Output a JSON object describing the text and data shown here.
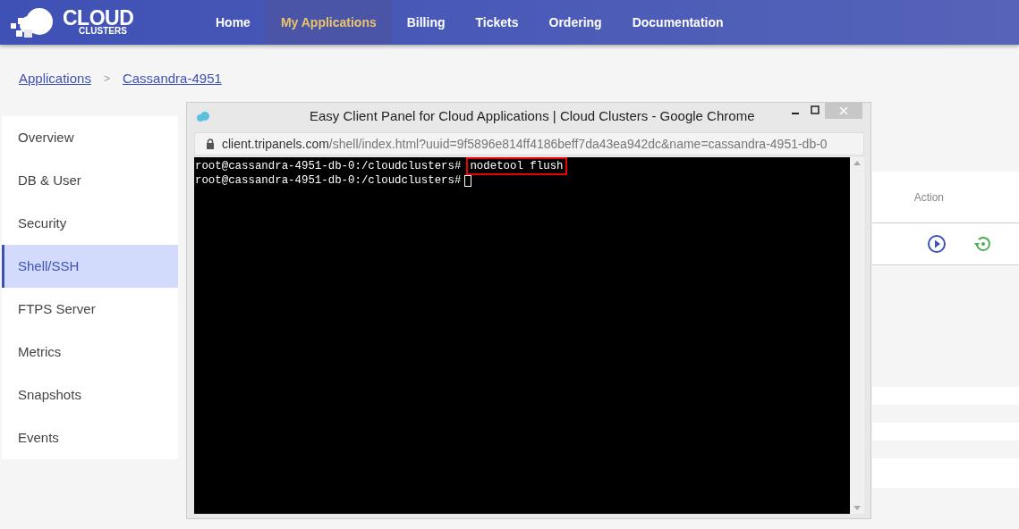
{
  "nav": [
    {
      "label": "Home",
      "selected": false
    },
    {
      "label": "My Applications",
      "selected": true
    },
    {
      "label": "Billing",
      "selected": false
    },
    {
      "label": "Tickets",
      "selected": false
    },
    {
      "label": "Ordering",
      "selected": false
    },
    {
      "label": "Documentation",
      "selected": false
    }
  ],
  "logo": {
    "line1": "CLOUD",
    "line2": "CLUSTERS"
  },
  "breadcrumb": [
    {
      "label": "Applications"
    },
    {
      "label": "Cassandra-4951"
    }
  ],
  "breadcrumb_separator": ">",
  "sidebar": [
    {
      "label": "Overview",
      "selected": false
    },
    {
      "label": "DB & User",
      "selected": false
    },
    {
      "label": "Security",
      "selected": false
    },
    {
      "label": "Shell/SSH",
      "selected": true
    },
    {
      "label": "FTPS Server",
      "selected": false
    },
    {
      "label": "Metrics",
      "selected": false
    },
    {
      "label": "Snapshots",
      "selected": false
    },
    {
      "label": "Events",
      "selected": false
    }
  ],
  "table": {
    "columns": [
      "Action"
    ]
  },
  "popup": {
    "title": "Easy Client Panel for Cloud Applications | Cloud Clusters - Google Chrome",
    "url_host": "client.tripanels.com",
    "url_path": "/shell/index.html?uuid=9f5896e814ff4186beff7da43ea942dc&name=cassandra-4951-db-0",
    "terminal": [
      {
        "prompt": "root@cassandra-4951-db-0:/cloudclusters#",
        "command": "nodetool flush",
        "highlighted": true,
        "cursor": false
      },
      {
        "prompt": "root@cassandra-4951-db-0:/cloudclusters#",
        "cursor": true
      }
    ]
  }
}
